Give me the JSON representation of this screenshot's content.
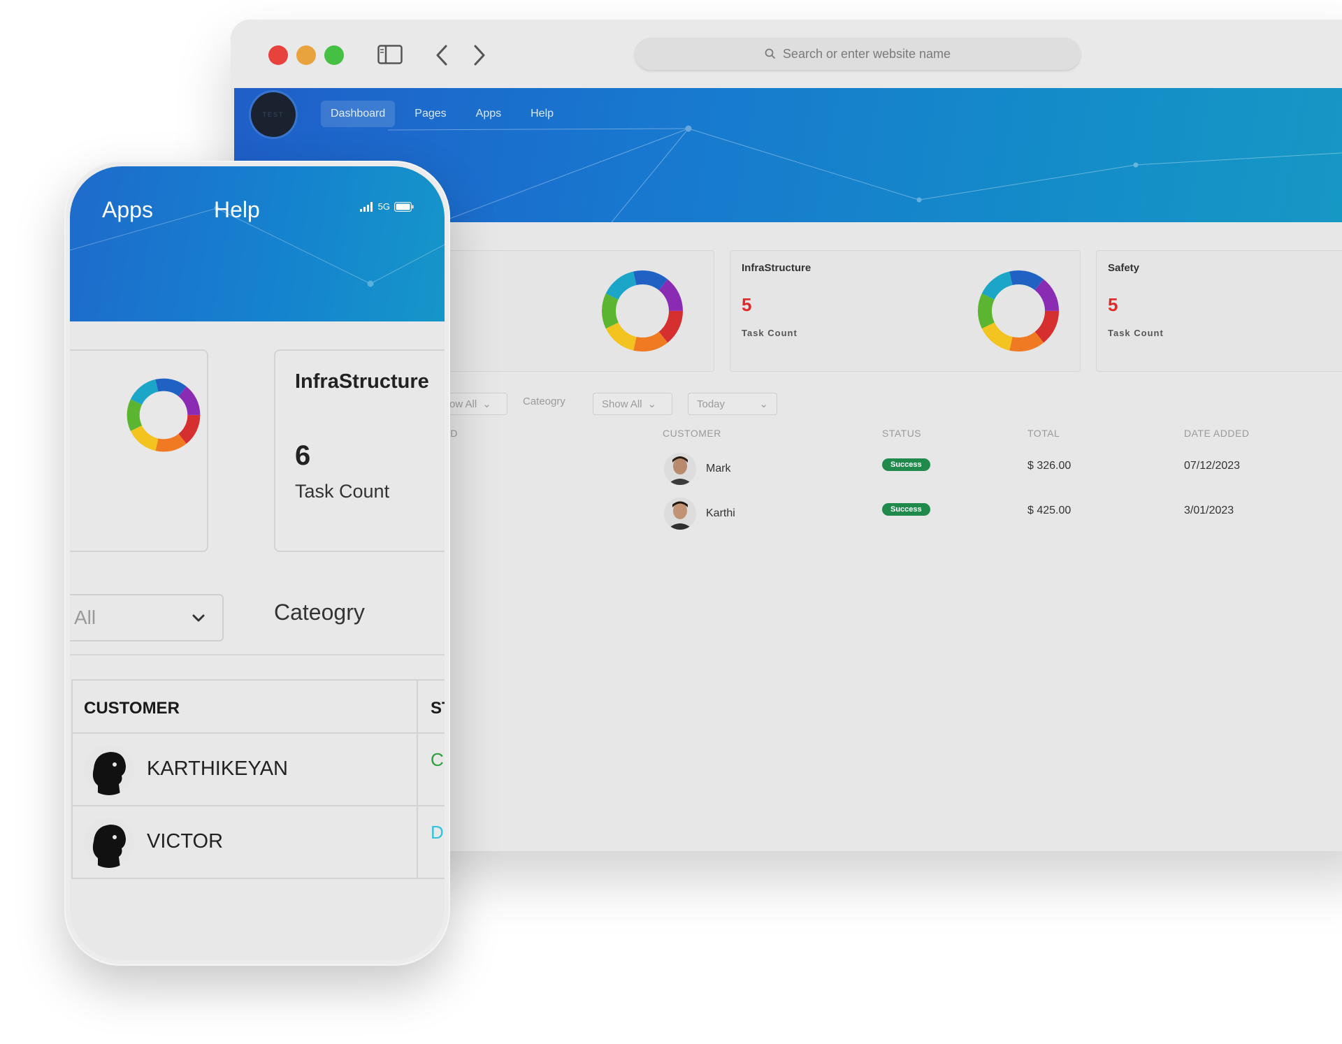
{
  "browser": {
    "url_placeholder": "Search or enter website name",
    "logo_text": "TEST",
    "menu": [
      "Dashboard",
      "Pages",
      "Apps",
      "Help"
    ],
    "cards": [
      {
        "title": "InfraStructure",
        "count": "5",
        "sub": "Task Count"
      },
      {
        "title": "Safety",
        "count": "5",
        "sub": "Task Count"
      }
    ],
    "filters": {
      "first_select": "ow All",
      "category_label": "Cateogry",
      "category_select": "Show All",
      "date_select": "Today"
    },
    "table": {
      "headers": [
        "ID",
        "CUSTOMER",
        "STATUS",
        "TOTAL",
        "DATE ADDED"
      ],
      "rows": [
        {
          "customer": "Mark",
          "status": "Success",
          "total": "$ 326.00",
          "date": "07/12/2023"
        },
        {
          "customer": "Karthi",
          "status": "Success",
          "total": "$ 425.00",
          "date": "3/01/2023"
        }
      ]
    }
  },
  "phone": {
    "menu": [
      "Apps",
      "Help"
    ],
    "network": "5G",
    "card": {
      "title": "InfraStructure",
      "count": "6",
      "sub": "Task Count"
    },
    "filter_select": "All",
    "category_label": "Cateogry",
    "table": {
      "headers": [
        "CUSTOMER",
        "ST"
      ],
      "rows": [
        {
          "name": "KARTHIKEYAN",
          "status": "C"
        },
        {
          "name": "VICTOR",
          "status": "DI"
        }
      ]
    }
  },
  "colors": {
    "hero_blue": "#1877cf",
    "count_red": "#e02a2a",
    "success_green": "#1f8a4c",
    "status_green": "#2aa13a",
    "status_cyan": "#2fc4dc"
  }
}
